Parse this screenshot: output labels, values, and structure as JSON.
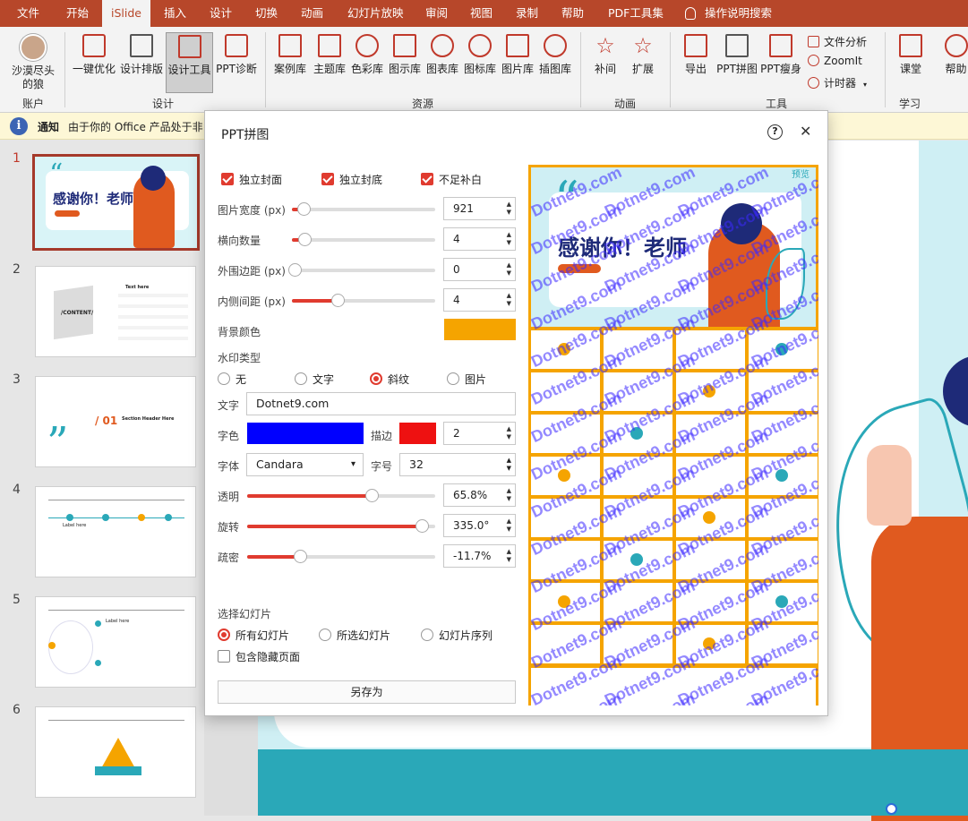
{
  "tabs": [
    "文件",
    "开始",
    "iSlide",
    "插入",
    "设计",
    "切换",
    "动画",
    "幻灯片放映",
    "审阅",
    "视图",
    "录制",
    "帮助",
    "PDF工具集"
  ],
  "active_tab": "iSlide",
  "tell_me": "操作说明搜索",
  "ribbon": {
    "account": {
      "name_line1": "沙漠尽头",
      "name_line2": "的狼",
      "group": "账户"
    },
    "design": {
      "btn1": "一键优化",
      "btn2": "设计排版",
      "btn3": "设计工具",
      "btn4": "PPT诊断",
      "group": "设计"
    },
    "resources": {
      "items": [
        "案例库",
        "主题库",
        "色彩库",
        "图示库",
        "图表库",
        "图标库",
        "图片库",
        "插图库"
      ],
      "group": "资源"
    },
    "animation": {
      "items": [
        "补间",
        "扩展"
      ],
      "group": "动画"
    },
    "tools": {
      "export": "导出",
      "puzzle": "PPT拼图",
      "slim": "PPT瘦身",
      "file_analysis": "文件分析",
      "zoomit": "ZoomIt",
      "timer": "计时器",
      "group": "工具"
    },
    "learn": {
      "class": "课堂",
      "help": "帮助",
      "group": "学习"
    }
  },
  "notice": {
    "label": "通知",
    "text": "由于你的 Office 产品处于非"
  },
  "slide_numbers": [
    "1",
    "2",
    "3",
    "4",
    "5",
    "6"
  ],
  "thumb_text": {
    "s1_title": "感谢你！老师",
    "s2_content": "/CONTENT/",
    "s2_item": "Text here",
    "s3_num": "/ 01",
    "s3_head": "Section Header Here",
    "s4_label": "Label here",
    "s5_label": "Label here"
  },
  "dialog": {
    "title": "PPT拼图",
    "help_icon": "?",
    "close_icon": "✕",
    "checkboxes": [
      "独立封面",
      "独立封底",
      "不足补白"
    ],
    "fields": {
      "width_label": "图片宽度 (px)",
      "width_value": "921",
      "width_pct": 0.08,
      "cols_label": "横向数量",
      "cols_value": "4",
      "cols_pct": 0.09,
      "outer_label": "外围边距 (px)",
      "outer_value": "0",
      "outer_pct": 0.02,
      "inner_label": "内侧间距 (px)",
      "inner_value": "4",
      "inner_pct": 0.32,
      "bg_label": "背景颜色",
      "bg_color": "#f5a400"
    },
    "watermark_type_label": "水印类型",
    "watermark_types": [
      "无",
      "文字",
      "斜纹",
      "图片"
    ],
    "watermark_selected": "斜纹",
    "text_label": "文字",
    "text_value": "Dotnet9.com",
    "color_label": "字色",
    "font_color": "#0000ff",
    "stroke_label": "描边",
    "stroke_color": "#ee1111",
    "stroke_value": "2",
    "font_label": "字体",
    "font_value": "Candara",
    "size_label": "字号",
    "size_value": "32",
    "opacity_label": "透明",
    "opacity_value": "65.8%",
    "opacity_pct": 0.66,
    "rotate_label": "旋转",
    "rotate_value": "335.0°",
    "rotate_pct": 0.93,
    "sparse_label": "疏密",
    "sparse_value": "-11.7%",
    "sparse_pct": 0.28,
    "select_label": "选择幻灯片",
    "select_options": [
      "所有幻灯片",
      "所选幻灯片",
      "幻灯片序列"
    ],
    "select_selected": "所有幻灯片",
    "hidden_label": "包含隐藏页面",
    "save_label": "另存为",
    "preview_badge": "预览",
    "watermark_text": "Dotnet9.com",
    "preview_title": "感谢你！老师"
  },
  "colors": {
    "accent": "#b7472a",
    "red": "#e03b2f",
    "orange": "#f5a400",
    "teal": "#2aa8b8"
  }
}
